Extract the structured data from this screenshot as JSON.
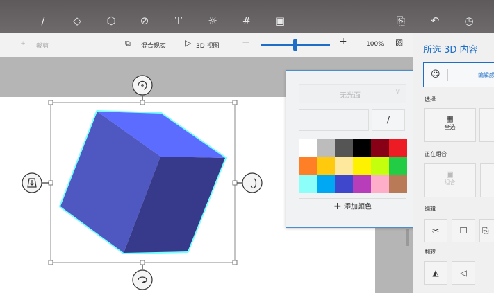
{
  "topbar": {
    "icons": [
      "brush-icon",
      "2d-shapes-icon",
      "3d-shapes-icon",
      "stickers-icon",
      "text-icon",
      "effects-icon",
      "canvas-icon",
      "remix3d-icon",
      "paste-icon",
      "undo-icon",
      "history-icon"
    ]
  },
  "toolbar": {
    "crop": "裁剪",
    "mixed_reality": "混合现实",
    "view_3d": "3D 视图",
    "zoom": "100%",
    "zoom_fraction": 0.5
  },
  "sidebar": {
    "title": "所选 3D 内容",
    "edit_color": "编辑颜色",
    "select_section": "选择",
    "select_all": "全选",
    "group_section": "正在组合",
    "group": "组合",
    "edit_section": "编辑",
    "flip_section": "翻转"
  },
  "popup": {
    "finish": "无光面",
    "add_color": "添加颜色",
    "swatches": [
      "#ffffff",
      "#bcbcbc",
      "#555555",
      "#000000",
      "#880015",
      "#ed1c24",
      "#ff7f27",
      "#ffc90e",
      "#fde89e",
      "#fff200",
      "#c4ff0e",
      "#22cc44",
      "#8cfffb",
      "#00a8f3",
      "#3f48cc",
      "#b83dba",
      "#ffaec9",
      "#b97a57"
    ]
  },
  "colors": {
    "accent": "#1e6ec8",
    "cube_top": "#5c6cff",
    "cube_left": "#4f57c0",
    "cube_right": "#373a8a"
  }
}
